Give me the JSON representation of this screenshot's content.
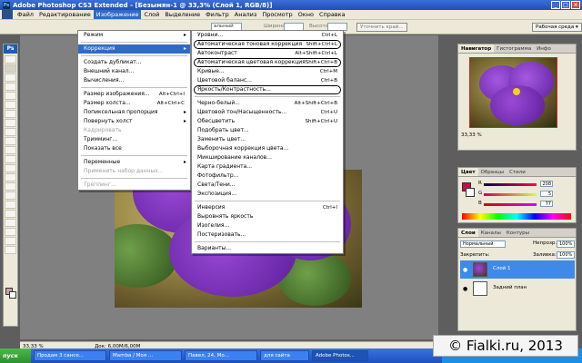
{
  "window": {
    "title": "Adobe Photoshop CS3 Extended - [Безымян-1 @ 33,3% (Слой 1, RGB/8)]"
  },
  "menubar": [
    "Файл",
    "Редактирование",
    "Изображение",
    "Слой",
    "Выделение",
    "Фильтр",
    "Анализ",
    "Просмотр",
    "Окно",
    "Справка"
  ],
  "options": {
    "mode_value": "альный",
    "width_label": "Ширина:",
    "height_label": "Высота:",
    "refine_button": "Уточнить край...",
    "workspace": "Рабочая среда ▾"
  },
  "image_menu": [
    {
      "label": "Режим",
      "sc": "",
      "arrow": true
    },
    {
      "sep": true
    },
    {
      "label": "Коррекция",
      "sc": "",
      "arrow": true,
      "hl": true
    },
    {
      "sep": true
    },
    {
      "label": "Создать дубликат...",
      "sc": ""
    },
    {
      "label": "Внешний канал...",
      "sc": ""
    },
    {
      "label": "Вычисления...",
      "sc": ""
    },
    {
      "sep": true
    },
    {
      "label": "Размер изображения...",
      "sc": "Alt+Ctrl+I"
    },
    {
      "label": "Размер холста...",
      "sc": "Alt+Ctrl+C"
    },
    {
      "label": "Попиксельная пропорция",
      "sc": "",
      "arrow": true
    },
    {
      "label": "Повернуть холст",
      "sc": "",
      "arrow": true
    },
    {
      "label": "Кадрировать",
      "sc": "",
      "dis": true
    },
    {
      "label": "Тримминг...",
      "sc": ""
    },
    {
      "label": "Показать все",
      "sc": ""
    },
    {
      "sep": true
    },
    {
      "label": "Переменные",
      "sc": "",
      "arrow": true
    },
    {
      "label": "Применить набор данных...",
      "sc": "",
      "dis": true
    },
    {
      "sep": true
    },
    {
      "label": "Треппинг...",
      "sc": "",
      "dis": true
    }
  ],
  "adjust_menu": [
    {
      "label": "Уровни...",
      "sc": "Ctrl+L"
    },
    {
      "label": "Автоматическая тоновая коррекция",
      "sc": "Shift+Ctrl+L",
      "circled": true
    },
    {
      "label": "Автоконтраст",
      "sc": "Alt+Shift+Ctrl+L"
    },
    {
      "label": "Автоматическая цветовая коррекция",
      "sc": "Shift+Ctrl+B",
      "circled": true
    },
    {
      "label": "Кривые...",
      "sc": "Ctrl+M"
    },
    {
      "label": "Цветовой баланс...",
      "sc": "Ctrl+B"
    },
    {
      "label": "Яркость/Контрастность...",
      "sc": "",
      "circled": true
    },
    {
      "sep": true
    },
    {
      "label": "Черно-белый...",
      "sc": "Alt+Shift+Ctrl+B"
    },
    {
      "label": "Цветовой тон/Насыщенность...",
      "sc": "Ctrl+U"
    },
    {
      "label": "Обесцветить",
      "sc": "Shift+Ctrl+U"
    },
    {
      "label": "Подобрать цвет...",
      "sc": ""
    },
    {
      "label": "Заменить цвет...",
      "sc": ""
    },
    {
      "label": "Выборочная коррекция цвета...",
      "sc": ""
    },
    {
      "label": "Микширование каналов...",
      "sc": ""
    },
    {
      "label": "Карта градиента...",
      "sc": ""
    },
    {
      "label": "Фотофильтр...",
      "sc": ""
    },
    {
      "label": "Света/Тени...",
      "sc": ""
    },
    {
      "label": "Экспозиция...",
      "sc": ""
    },
    {
      "sep": true
    },
    {
      "label": "Инверсия",
      "sc": "Ctrl+I"
    },
    {
      "label": "Выровнять яркость",
      "sc": ""
    },
    {
      "label": "Изогелия...",
      "sc": ""
    },
    {
      "label": "Постеризовать...",
      "sc": ""
    },
    {
      "sep": true
    },
    {
      "label": "Варианты...",
      "sc": ""
    }
  ],
  "status": {
    "zoom": "33,33 %",
    "doc": "Док: 6,00M/6,00M"
  },
  "navigator": {
    "tabs": [
      "Навигатор",
      "Гистограмма",
      "Инфо"
    ],
    "zoom": "33,33 %"
  },
  "color": {
    "tabs": [
      "Цвет",
      "Образцы",
      "Стили"
    ],
    "r": "R",
    "g": "G",
    "b": "B",
    "r_val": "208",
    "g_val": "5",
    "b_val": "77",
    "fg_color": "#d0054d"
  },
  "layers": {
    "tabs": [
      "Слои",
      "Каналы",
      "Контуры"
    ],
    "mode": "Нормальный",
    "opacity_label": "Непрозр.:",
    "opacity": "100%",
    "lock_label": "Закрепить:",
    "fill_label": "Заливка:",
    "fill": "100%",
    "items": [
      {
        "name": "Слой 1",
        "selected": true
      },
      {
        "name": "Задний план",
        "selected": false
      }
    ]
  },
  "taskbar": {
    "start": "пуск",
    "tasks": [
      "Продам 3 сансе...",
      "Mamba / Моя ...",
      "Павел, 24, Мо...",
      "для сайта",
      "Adobe Photos..."
    ]
  },
  "watermark": "© Fialki.ru, 2013"
}
